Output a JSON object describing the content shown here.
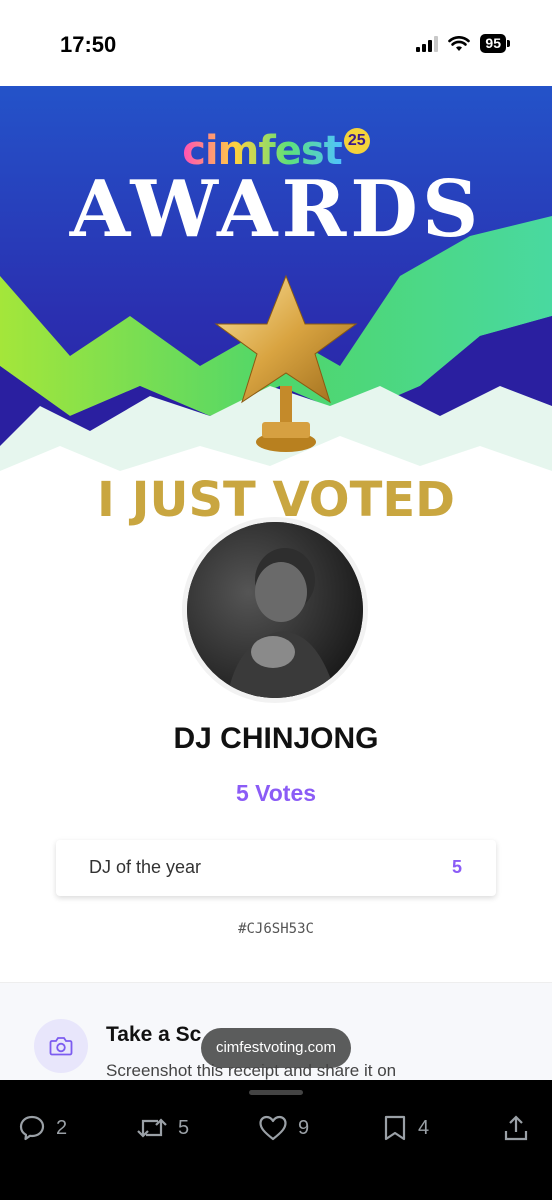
{
  "status_bar": {
    "time": "17:50",
    "battery": "95"
  },
  "banner": {
    "logo_text": "cimfest",
    "logo_badge": "25",
    "title": "AWARDS"
  },
  "heading": "I JUST VOTED",
  "artist": {
    "name": "DJ CHINJONG",
    "votes_label": "5 Votes"
  },
  "category": {
    "name": "DJ of the year",
    "votes": "5"
  },
  "receipt_code": "#CJ6SH53C",
  "tip": {
    "icon": "camera-icon",
    "title": "Take a Sc",
    "body": "Screenshot this receipt and share it on"
  },
  "url_pill": "cimfestvoting.com",
  "actions": [
    {
      "icon": "reply-icon",
      "count": "2"
    },
    {
      "icon": "repost-icon",
      "count": "5"
    },
    {
      "icon": "like-icon",
      "count": "9"
    },
    {
      "icon": "bookmark-icon",
      "count": "4"
    },
    {
      "icon": "share-icon",
      "count": ""
    }
  ],
  "colors": {
    "accent_purple": "#8b5cf6",
    "gold": "#c9a640",
    "banner_blue": "#2a2fb0",
    "banner_green": "#5ee07a"
  }
}
